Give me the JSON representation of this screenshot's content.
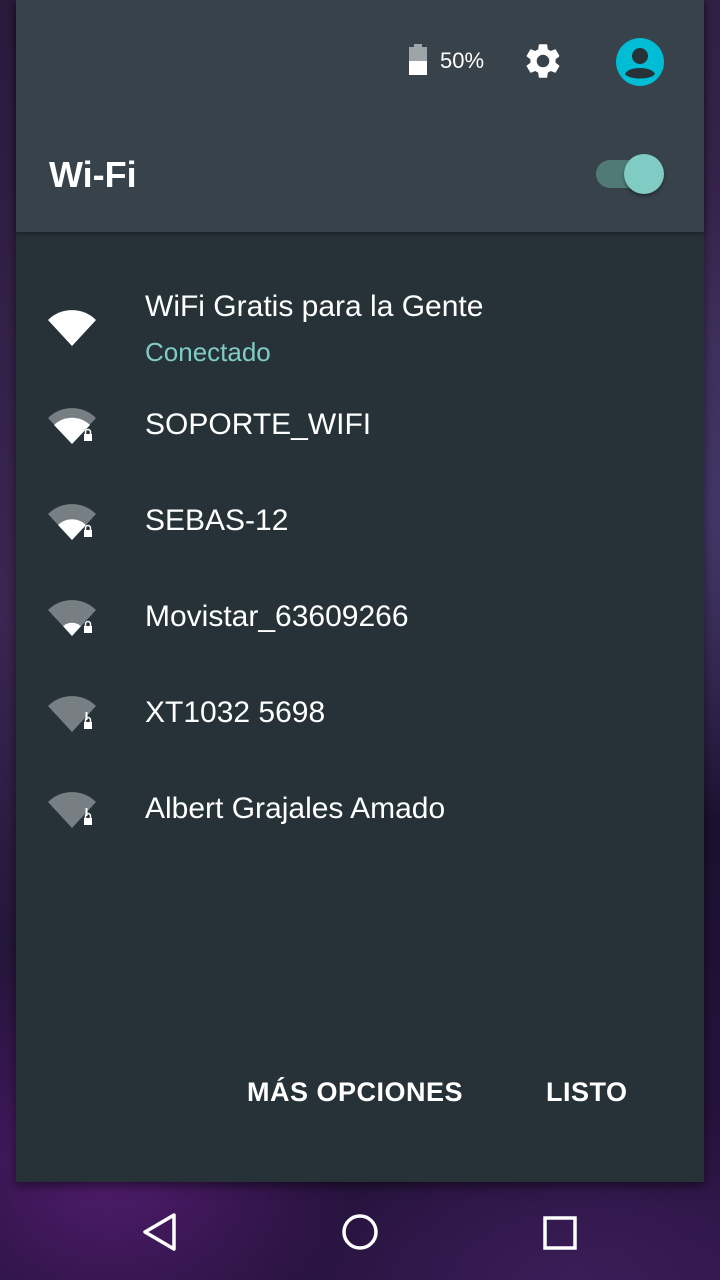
{
  "status": {
    "battery_percent": "50%",
    "battery_level": 0.5,
    "settings_icon": "gear-icon",
    "account_icon": "account-circle-icon"
  },
  "header": {
    "title": "Wi-Fi",
    "wifi_enabled": true
  },
  "networks": [
    {
      "name": "WiFi Gratis para la Gente",
      "status": "Conectado",
      "signal_bars": 4,
      "secured": false
    },
    {
      "name": "SOPORTE_WIFI",
      "signal_bars": 3,
      "secured": true
    },
    {
      "name": "SEBAS-12",
      "signal_bars": 2,
      "secured": true
    },
    {
      "name": "Movistar_63609266",
      "signal_bars": 1,
      "secured": true
    },
    {
      "name": "XT1032 5698",
      "signal_bars": 0,
      "secured": true
    },
    {
      "name": "Albert Grajales Amado",
      "signal_bars": 0,
      "secured": true
    }
  ],
  "actions": {
    "more_options": "MÁS OPCIONES",
    "done": "LISTO"
  },
  "colors": {
    "accent": "#80cbc4",
    "panel": "#263238",
    "header": "#37424a",
    "avatar": "#00bcd4"
  },
  "navigation": {
    "back_icon": "back-triangle-icon",
    "home_icon": "home-circle-icon",
    "recents_icon": "recents-square-icon"
  }
}
